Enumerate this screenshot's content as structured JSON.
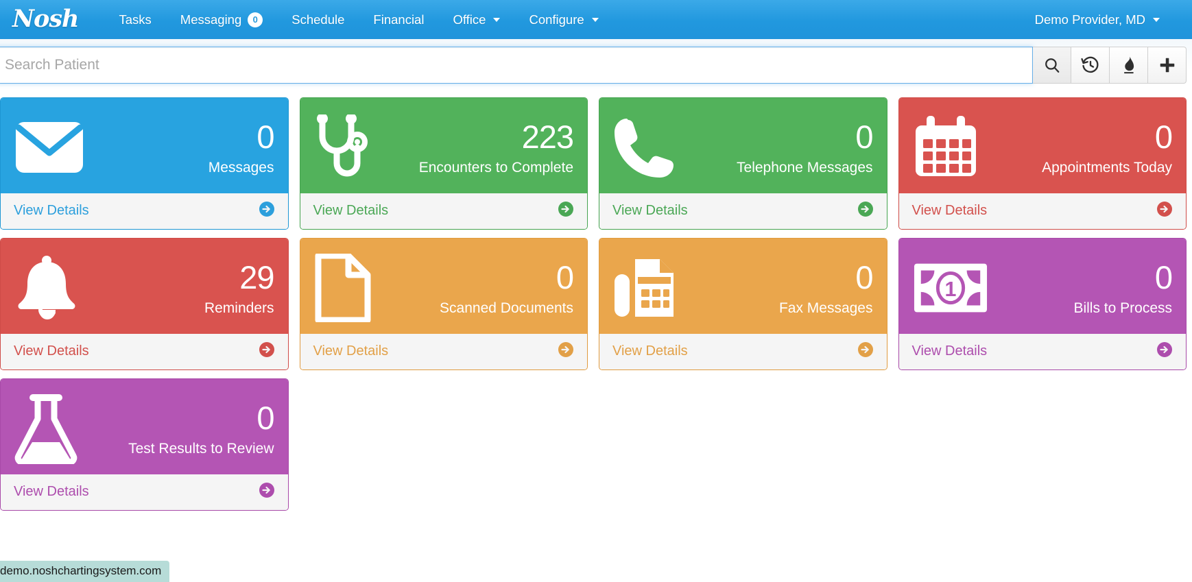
{
  "navbar": {
    "brand": "Nosh",
    "items": [
      {
        "label": "Tasks",
        "badge": null,
        "caret": false
      },
      {
        "label": "Messaging",
        "badge": "0",
        "caret": false
      },
      {
        "label": "Schedule",
        "badge": null,
        "caret": false
      },
      {
        "label": "Financial",
        "badge": null,
        "caret": false
      },
      {
        "label": "Office",
        "badge": null,
        "caret": true
      },
      {
        "label": "Configure",
        "badge": null,
        "caret": true
      }
    ],
    "user": "Demo Provider, MD"
  },
  "search": {
    "placeholder": "Search Patient",
    "value": "",
    "buttons": [
      {
        "icon": "search-icon",
        "name": "search-submit-button"
      },
      {
        "icon": "history-icon",
        "name": "recent-patients-button"
      },
      {
        "icon": "flame-icon",
        "name": "hot-list-button"
      },
      {
        "icon": "plus-icon",
        "name": "add-patient-button"
      }
    ]
  },
  "cards": [
    {
      "id": "messages",
      "count": "0",
      "label": "Messages",
      "link": "View Details",
      "icon": "envelope-icon",
      "color": "#28a3e0",
      "border": "#1d96d3",
      "link_color": "#2c9fdc"
    },
    {
      "id": "encounters-to-complete",
      "count": "223",
      "label": "Encounters to Complete",
      "link": "View Details",
      "icon": "stethoscope-icon",
      "color": "#52b25b",
      "border": "#45a34f",
      "link_color": "#4aa755"
    },
    {
      "id": "telephone-messages",
      "count": "0",
      "label": "Telephone Messages",
      "link": "View Details",
      "icon": "phone-icon",
      "color": "#52b25b",
      "border": "#45a34f",
      "link_color": "#4aa755"
    },
    {
      "id": "appointments-today",
      "count": "0",
      "label": "Appointments Today",
      "link": "View Details",
      "icon": "calendar-icon",
      "color": "#d9534f",
      "border": "#ce4b47",
      "link_color": "#d2504c"
    },
    {
      "id": "reminders",
      "count": "29",
      "label": "Reminders",
      "link": "View Details",
      "icon": "bell-icon",
      "color": "#d9534f",
      "border": "#ce4b47",
      "link_color": "#d2504c"
    },
    {
      "id": "scanned-documents",
      "count": "0",
      "label": "Scanned Documents",
      "link": "View Details",
      "icon": "document-icon",
      "color": "#eaa64c",
      "border": "#e09a3e",
      "link_color": "#e2a047"
    },
    {
      "id": "fax-messages",
      "count": "0",
      "label": "Fax Messages",
      "link": "View Details",
      "icon": "fax-icon",
      "color": "#eaa64c",
      "border": "#e09a3e",
      "link_color": "#e2a047"
    },
    {
      "id": "bills-to-process",
      "count": "0",
      "label": "Bills to Process",
      "link": "View Details",
      "icon": "money-bill-icon",
      "color": "#b455b4",
      "border": "#a849a8",
      "link_color": "#ad4dad"
    },
    {
      "id": "test-results-to-review",
      "count": "0",
      "label": "Test Results to Review",
      "link": "View Details",
      "icon": "flask-icon",
      "color": "#b455b4",
      "border": "#a849a8",
      "link_color": "#ad4dad"
    }
  ],
  "statusbar": {
    "url": "demo.noshchartingsystem.com"
  }
}
